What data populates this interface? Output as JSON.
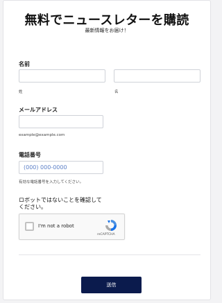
{
  "header": {
    "title": "無料でニュースレターを購読",
    "subtitle": "最新情報をお届け！"
  },
  "form": {
    "name": {
      "label": "名前",
      "last_value": "",
      "first_value": "",
      "last_hint": "姓",
      "first_hint": "名"
    },
    "email": {
      "label": "メールアドレス",
      "value": "",
      "hint": "example@example.com"
    },
    "phone": {
      "label": "電話番号",
      "placeholder": "(000) 000-0000",
      "value": "",
      "hint": "有効な電話番号を入力してください。"
    },
    "captcha_section": {
      "label": "ロボットではないことを確認して ください。",
      "checkbox_label": "I'm not a robot",
      "brand": "reCAPTCHA",
      "checked": false
    },
    "submit_label": "送信"
  },
  "colors": {
    "submit_bg": "#0b1b4d",
    "placeholder": "#5b7fc7",
    "page_bg": "#f3f3f5"
  }
}
